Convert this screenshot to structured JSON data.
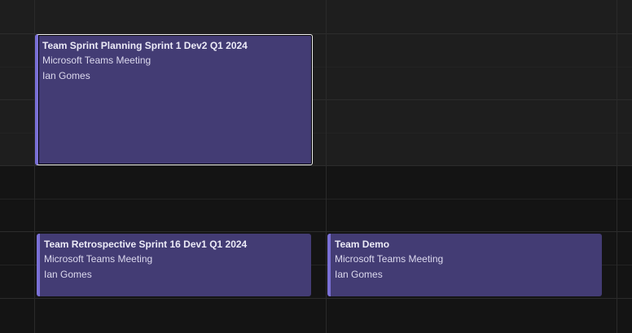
{
  "events": [
    {
      "title": "Team Sprint Planning Sprint 1 Dev2 Q1 2024",
      "location": "Microsoft Teams Meeting",
      "organizer": "Ian Gomes",
      "selected": true
    },
    {
      "title": "Team Retrospective Sprint 16 Dev1 Q1 2024",
      "location": "Microsoft Teams Meeting",
      "organizer": "Ian Gomes",
      "selected": false
    },
    {
      "title": "Team Demo",
      "location": "Microsoft Teams Meeting",
      "organizer": "Ian Gomes",
      "selected": false
    }
  ],
  "colors": {
    "event_fill": "#433c74",
    "event_accent": "#7a70d6",
    "working_hours_bg": "#1e1e1e",
    "off_hours_bg": "#141414"
  }
}
